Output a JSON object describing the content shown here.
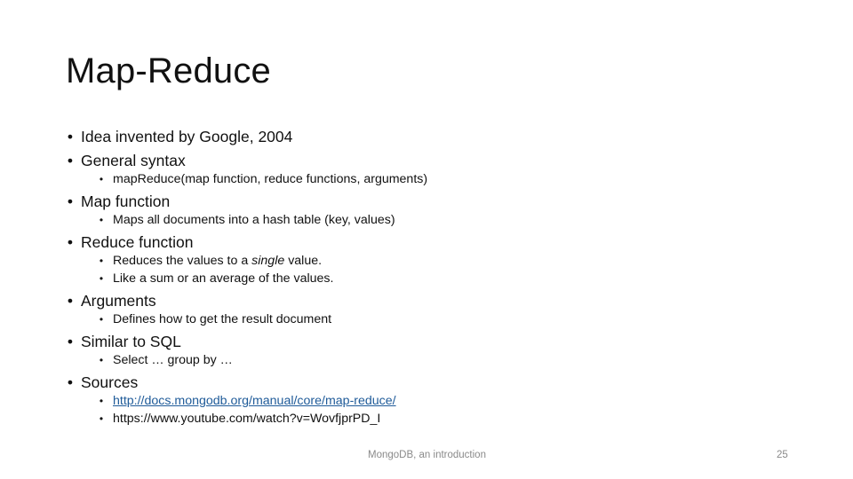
{
  "slide": {
    "title": "Map-Reduce",
    "bullets": [
      {
        "text": "Idea invented by Google, 2004",
        "children": []
      },
      {
        "text": "General syntax",
        "children": [
          {
            "text": "mapReduce(map function, reduce functions, arguments)"
          }
        ]
      },
      {
        "text": "Map function",
        "children": [
          {
            "text": "Maps all documents into a hash table (key, values)"
          }
        ]
      },
      {
        "text": "Reduce function",
        "children": [
          {
            "pre": "Reduces the values to a ",
            "em": "single",
            "post": " value."
          },
          {
            "text": "Like a sum or an average of the values."
          }
        ]
      },
      {
        "text": "Arguments",
        "children": [
          {
            "text": "Defines how to get the result document"
          }
        ]
      },
      {
        "text": "Similar to SQL",
        "children": [
          {
            "text": "Select … group by …"
          }
        ]
      },
      {
        "text": "Sources",
        "children": [
          {
            "text": "http://docs.mongodb.org/manual/core/map-reduce/",
            "is_link": true
          },
          {
            "text": "https://www.youtube.com/watch?v=WovfjprPD_I"
          }
        ]
      }
    ],
    "bullet_glyph": "•"
  },
  "footer": {
    "center_text": "MongoDB, an introduction",
    "page_number": "25"
  },
  "colors": {
    "link": "#1f5b99",
    "footer_text": "#8a8a8a"
  }
}
